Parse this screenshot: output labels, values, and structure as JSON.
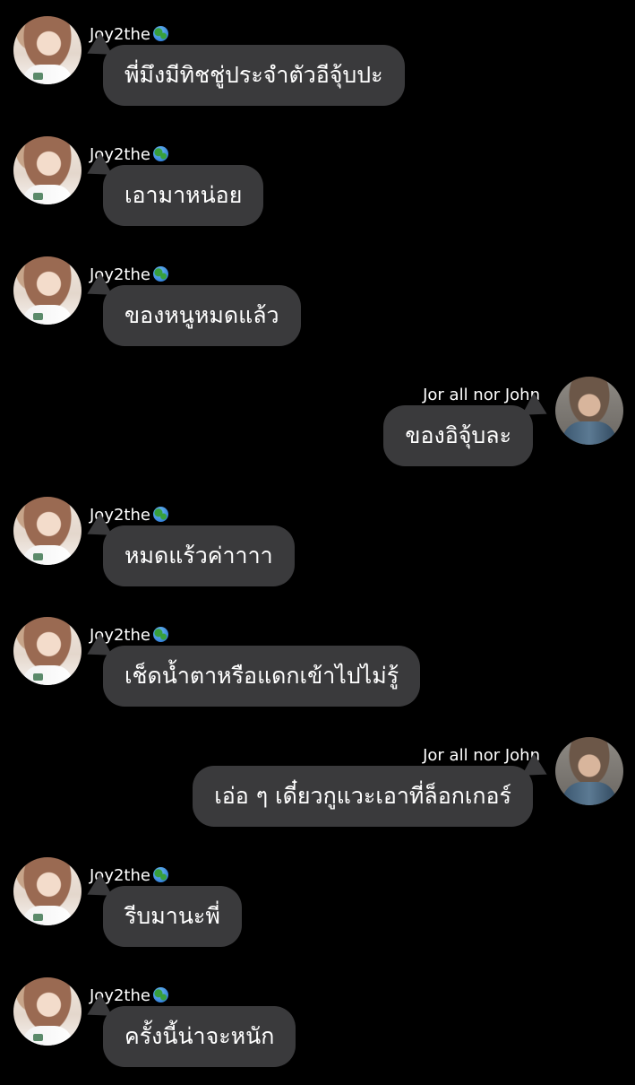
{
  "messages": [
    {
      "sender": "Joy2the",
      "side": "left",
      "text": "พี่มึงมีทิชชู่ประจำตัวอีจุ้บปะ",
      "icon": "globe-icon"
    },
    {
      "sender": "Joy2the",
      "side": "left",
      "text": "เอามาหน่อย",
      "icon": "globe-icon"
    },
    {
      "sender": "Joy2the",
      "side": "left",
      "text": "ของหนูหมดแล้ว",
      "icon": "globe-icon"
    },
    {
      "sender": "Jor all nor John",
      "side": "right",
      "text": "ของอิจุ้บละ",
      "icon": ""
    },
    {
      "sender": "Joy2the",
      "side": "left",
      "text": "หมดแร้วค่าาาา",
      "icon": "globe-icon"
    },
    {
      "sender": "Joy2the",
      "side": "left",
      "text": "เช็ดน้ำตาหรือแดกเข้าไปไม่รู้",
      "icon": "globe-icon"
    },
    {
      "sender": "Jor all nor John",
      "side": "right",
      "text": "เอ่อ ๆ เดี๋ยวกูแวะเอาที่ล็อกเกอร์",
      "icon": ""
    },
    {
      "sender": "Joy2the",
      "side": "left",
      "text": "รีบมานะพี่",
      "icon": "globe-icon"
    },
    {
      "sender": "Joy2the",
      "side": "left",
      "text": "ครั้งนี้น่าจะหนัก",
      "icon": "globe-icon"
    }
  ]
}
